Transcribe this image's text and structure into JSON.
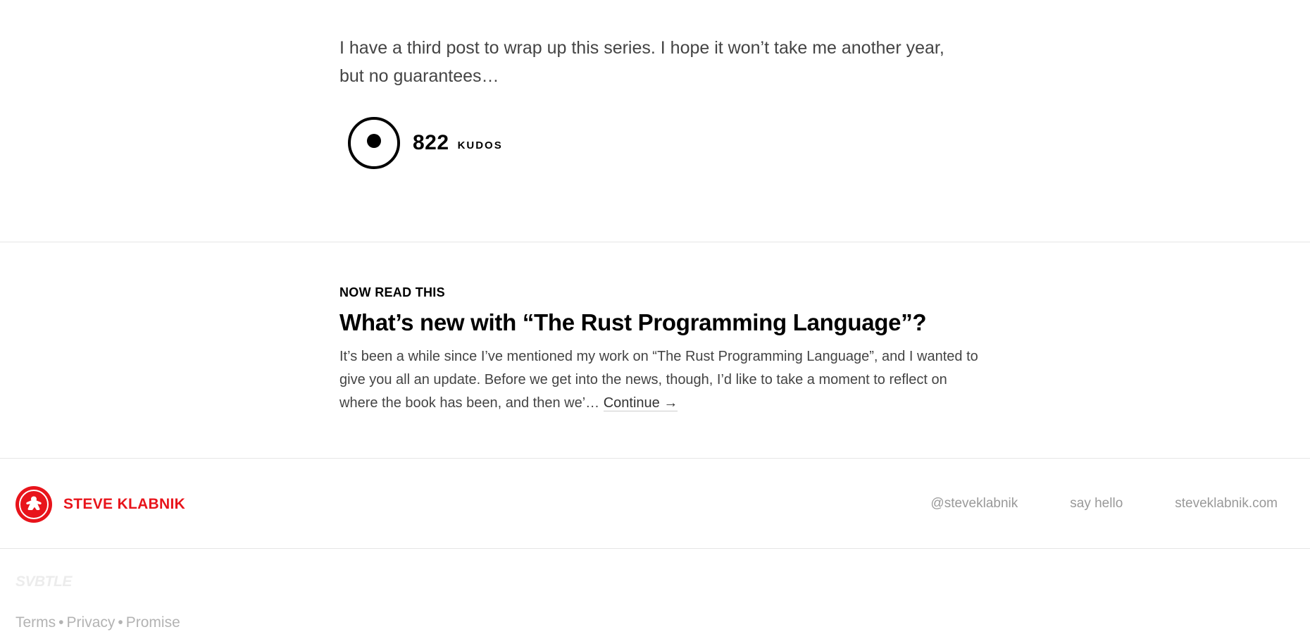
{
  "article": {
    "closing_text": "I have a third post to wrap up this series. I hope it won’t take me another year, but no guarantees…"
  },
  "kudos": {
    "count": "822",
    "label": "KUDOS"
  },
  "read_next": {
    "heading": "NOW READ THIS",
    "title": "What’s new with “The Rust Programming Language”?",
    "excerpt": "It’s been a while since I’ve mentioned my work on “The Rust Programming Language”, and I wanted to give you all an update. Before we get into the news, though, I’d like to take a moment to reflect on where the book has been, and then we’…",
    "continue_label": "Continue →"
  },
  "footer": {
    "brand_name": "STEVE KLABNIK",
    "brand_color": "#e8141b",
    "links": [
      {
        "label": "@steveklabnik"
      },
      {
        "label": "say hello"
      },
      {
        "label": "steveklabnik.com"
      }
    ],
    "platform": "SVBTLE",
    "legal": {
      "terms": "Terms",
      "privacy": "Privacy",
      "promise": "Promise",
      "separator": "•"
    }
  }
}
